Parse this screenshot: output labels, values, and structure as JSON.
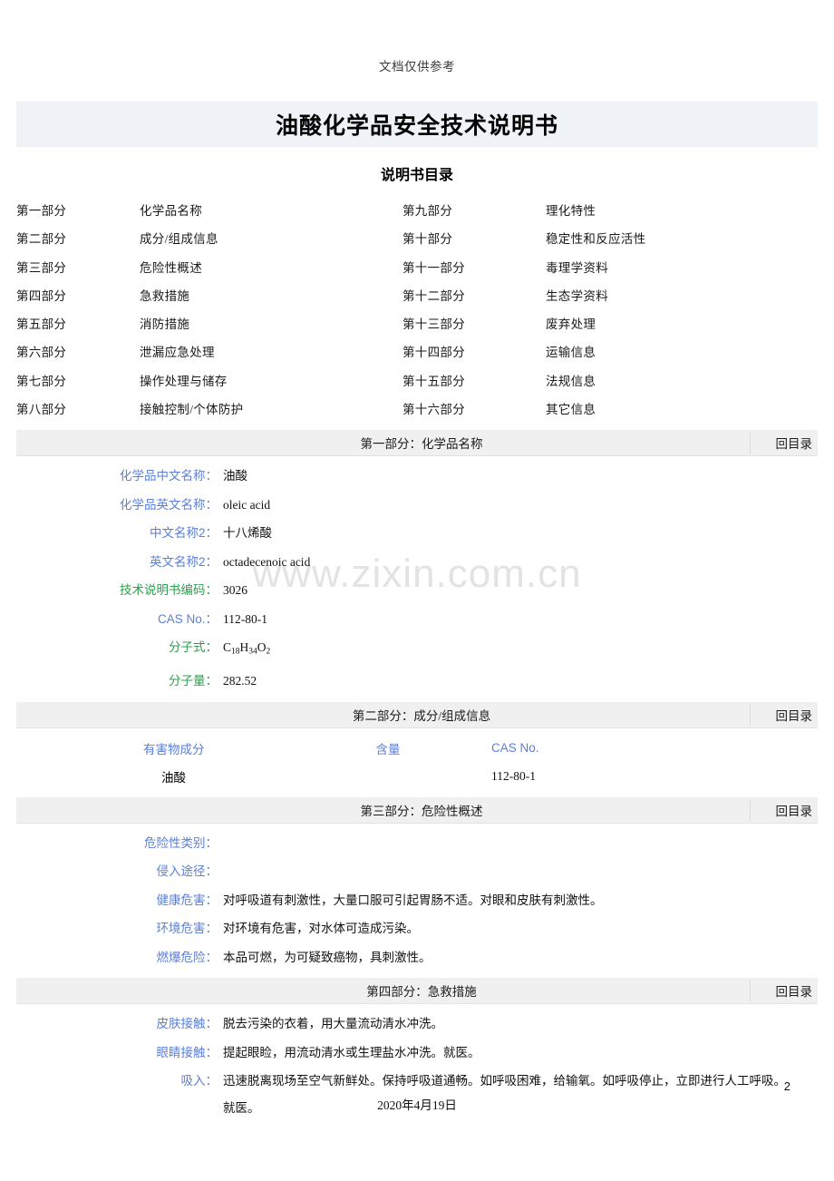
{
  "top_note": "文档仅供参考",
  "title": "油酸化学品安全技术说明书",
  "toc": {
    "heading": "说明书目录",
    "rows": [
      {
        "left_part": "第一部分",
        "left_name": "化学品名称",
        "right_part": "第九部分",
        "right_name": "理化特性"
      },
      {
        "left_part": "第二部分",
        "left_name": "成分/组成信息",
        "right_part": "第十部分",
        "right_name": "稳定性和反应活性"
      },
      {
        "left_part": "第三部分",
        "left_name": "危险性概述",
        "right_part": "第十一部分",
        "right_name": "毒理学资料"
      },
      {
        "left_part": "第四部分",
        "left_name": "急救措施",
        "right_part": "第十二部分",
        "right_name": "生态学资料"
      },
      {
        "left_part": "第五部分",
        "left_name": "消防措施",
        "right_part": "第十三部分",
        "right_name": "废弃处理"
      },
      {
        "left_part": "第六部分",
        "left_name": "泄漏应急处理",
        "right_part": "第十四部分",
        "right_name": "运输信息"
      },
      {
        "left_part": "第七部分",
        "left_name": "操作处理与储存",
        "right_part": "第十五部分",
        "right_name": "法规信息"
      },
      {
        "left_part": "第八部分",
        "left_name": "接触控制/个体防护",
        "right_part": "第十六部分",
        "right_name": "其它信息"
      }
    ]
  },
  "back_to_toc": "回目录",
  "section1": {
    "title": "第一部分：化学品名称",
    "fields": [
      {
        "label": "化学品中文名称：",
        "value": "油酸"
      },
      {
        "label": "化学品英文名称：",
        "value": "oleic acid"
      },
      {
        "label": "中文名称2：",
        "value": "十八烯酸"
      },
      {
        "label": "英文名称2：",
        "value": "octadecenoic acid"
      },
      {
        "label": "技术说明书编码：",
        "value": "3026"
      },
      {
        "label": "CAS No.：",
        "value": "112-80-1"
      },
      {
        "label": "分子式：",
        "value": "C18H34O2"
      },
      {
        "label": "分子量：",
        "value": "282.52"
      }
    ],
    "formula": {
      "c": "C",
      "c_sub": "18",
      "h": "H",
      "h_sub": "34",
      "o": "O",
      "o_sub": "2"
    }
  },
  "section2": {
    "title": "第二部分：成分/组成信息",
    "headers": {
      "component": "有害物成分",
      "content": "含量",
      "cas": "CAS No."
    },
    "rows": [
      {
        "component": "油酸",
        "content": "",
        "cas": "112-80-1"
      }
    ]
  },
  "section3": {
    "title": "第三部分：危险性概述",
    "fields": [
      {
        "label": "危险性类别：",
        "value": ""
      },
      {
        "label": "侵入途径：",
        "value": ""
      },
      {
        "label": "健康危害：",
        "value": "对呼吸道有刺激性，大量口服可引起胃肠不适。对眼和皮肤有刺激性。"
      },
      {
        "label": "环境危害：",
        "value": "对环境有危害，对水体可造成污染。"
      },
      {
        "label": "燃爆危险：",
        "value": "本品可燃，为可疑致癌物，具刺激性。"
      }
    ]
  },
  "section4": {
    "title": "第四部分：急救措施",
    "fields": [
      {
        "label": "皮肤接触：",
        "value": "脱去污染的衣着，用大量流动清水冲洗。"
      },
      {
        "label": "眼睛接触：",
        "value": "提起眼睑，用流动清水或生理盐水冲洗。就医。"
      },
      {
        "label": "吸入：",
        "value": "迅速脱离现场至空气新鲜处。保持呼吸道通畅。如呼吸困难，给输氧。如呼吸停止，立即进行人工呼吸。",
        "value_line2": "就医。"
      }
    ]
  },
  "watermark": "www.zixin.com.cn",
  "footer": {
    "date": "2020年4月19日",
    "page": "2"
  },
  "colors": {
    "label_blue": "#5b7fd4",
    "label_green": "#2e9e4e",
    "title_bar_bg": "#eff3f7",
    "section_bar_bg": "#f0f0f0",
    "watermark": "#e3e3e3"
  }
}
